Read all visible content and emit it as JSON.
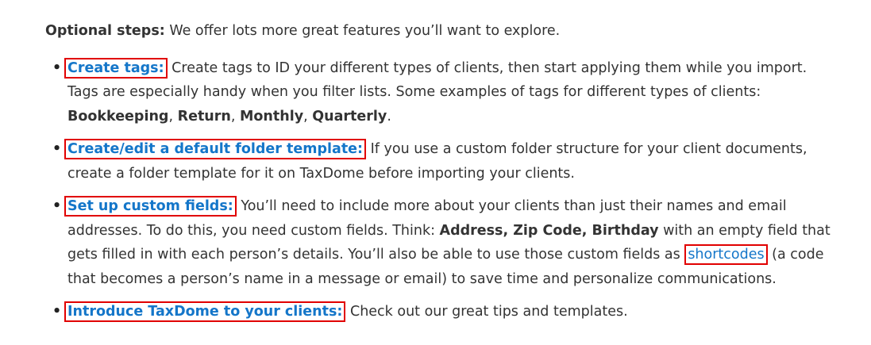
{
  "intro": {
    "label": "Optional steps:",
    "text": " We offer lots more great features you’ll want to explore."
  },
  "steps": [
    {
      "link": "Create tags:",
      "text": " Create tags to ID your different types of clients, then start applying them while you import. Tags are especially handy when you filter lists. Some examples of tags for different types of clients: ",
      "tags": [
        "Bookkeeping",
        "Return",
        "Monthly",
        "Quarterly"
      ],
      "sep": ", ",
      "end": "."
    },
    {
      "link": "Create/edit a default folder template:",
      "text": " If you use a custom folder structure for your client documents, create a folder template for it on TaxDome before importing your clients."
    },
    {
      "link": "Set up custom fields:",
      "text_a": " You’ll need to include more about your clients than just their names and email addresses. To do this, you need custom fields. Think: ",
      "fields": "Address, Zip Code, Birthday",
      "text_b": " with an empty field that gets filled in with each person’s details. You’ll also be able to use those custom fields as ",
      "shortcodes_link": "shortcodes",
      "text_c": " (a code that becomes a person’s name in a message or email) to save time and personalize communications."
    },
    {
      "link": "Introduce TaxDome to your clients:",
      "text": " Check out our great tips and templates."
    }
  ],
  "bullet": "•",
  "colors": {
    "link": "#1476c9",
    "highlight_box": "#e10000",
    "text": "#333333"
  }
}
